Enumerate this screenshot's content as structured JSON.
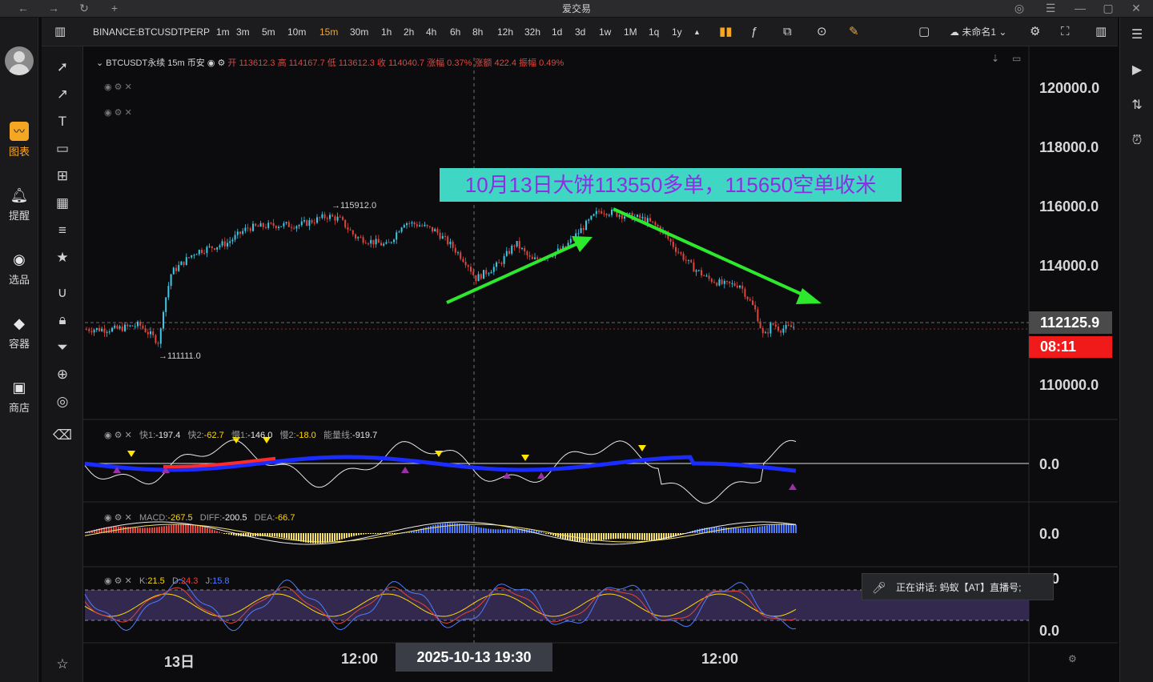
{
  "window": {
    "title": "爱交易",
    "controls": [
      "←",
      "→",
      "↻",
      "+"
    ],
    "right_controls": [
      "headset-icon",
      "menu-icon",
      "minimize-icon",
      "maximize-icon",
      "close-icon"
    ]
  },
  "left_nav": {
    "items": [
      {
        "label": "图表",
        "icon": "chart-icon",
        "active": true
      },
      {
        "label": "提醒",
        "icon": "bell-icon"
      },
      {
        "label": "选品",
        "icon": "search-chart-icon"
      },
      {
        "label": "容器",
        "icon": "container-icon"
      },
      {
        "label": "商店",
        "icon": "store-icon"
      }
    ]
  },
  "toolbar": {
    "symbol": "BINANCE:BTCUSDTPERP",
    "intervals": [
      "1m",
      "3m",
      "5m",
      "10m",
      "15m",
      "30m",
      "1h",
      "2h",
      "4h",
      "6h",
      "8h",
      "12h",
      "32h",
      "1d",
      "3d",
      "1w",
      "1M",
      "1q",
      "1y"
    ],
    "active_interval": "15m",
    "layout_name": "未命名1",
    "accent": "#f5a623"
  },
  "legend": {
    "symbol_line": "BTCUSDT永续 15m 币安",
    "ohlc": "开 113612.3 高 114167.7 低 113612.3 收 114040.7 涨幅 0.37% 涨额 422.4 振幅 0.49%"
  },
  "annotation": {
    "text": "10月13日大饼113550多单，115650空单收米",
    "bg": "#3fd6c4",
    "color": "#8e2de2"
  },
  "price_axis": {
    "labels": [
      "120000.0",
      "118000.0",
      "116000.0",
      "114000.0",
      "110000.0"
    ],
    "current_price": "112125.9",
    "countdown": "08:11"
  },
  "chart_marks": {
    "high_label": "→115912.0",
    "low_label": "→111111.0"
  },
  "indicator1": {
    "items": [
      {
        "name": "快1:",
        "value": "-197.4",
        "color": "#e8e8e8"
      },
      {
        "name": "快2:",
        "value": "-62.7",
        "color": "#ffd700"
      },
      {
        "name": "慢1:",
        "value": "-146.0",
        "color": "#e8e8e8"
      },
      {
        "name": "慢2:",
        "value": "-18.0",
        "color": "#ffd700"
      },
      {
        "name": "能量线:",
        "value": "-919.7",
        "color": "#e8e8e8"
      }
    ],
    "axis": "0.0"
  },
  "indicator2": {
    "items": [
      {
        "name": "MACD:",
        "value": "-267.5",
        "color": "#ffd700"
      },
      {
        "name": "DIFF:",
        "value": "-200.5",
        "color": "#e8e8e8"
      },
      {
        "name": "DEA:",
        "value": "-66.7",
        "color": "#ffd700"
      }
    ],
    "axis": "0.0"
  },
  "indicator3": {
    "items": [
      {
        "name": "K:",
        "value": "21.5",
        "color": "#ffd700"
      },
      {
        "name": "D:",
        "value": "24.3",
        "color": "#e0463d"
      },
      {
        "name": "J:",
        "value": "15.8",
        "color": "#4d7cff"
      }
    ],
    "axis_top": "0.0",
    "axis_bottom": "0.0"
  },
  "time_axis": {
    "labels": [
      "13日",
      "12:00",
      "12:00"
    ],
    "crosshair": "2025-10-13  19:30"
  },
  "speaking": {
    "text": "正在讲话:  蚂蚁【AT】直播号;"
  }
}
